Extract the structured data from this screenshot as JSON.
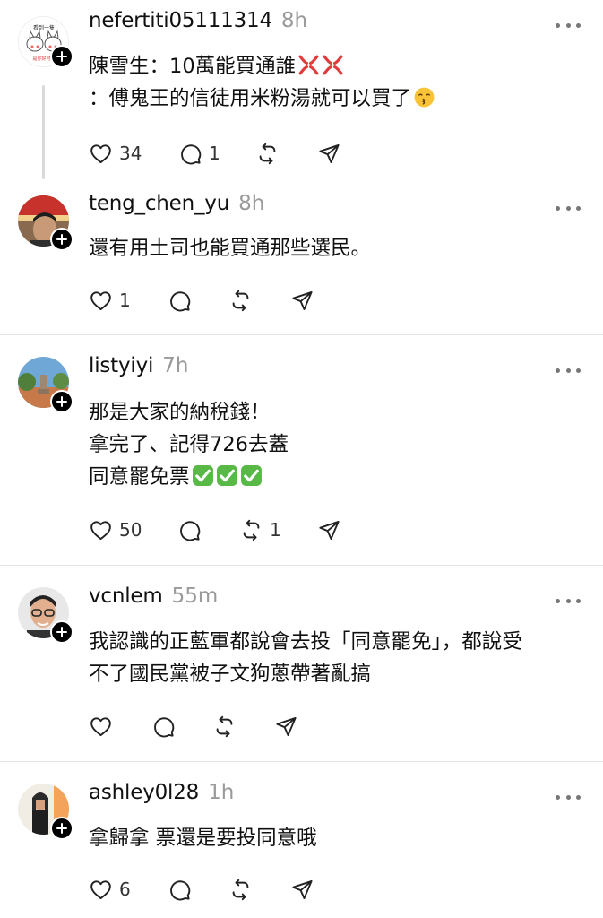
{
  "icons": {
    "like": "heart-icon",
    "reply": "comment-bubble-icon",
    "repost": "repost-arrows-icon",
    "share": "send-paper-plane-icon",
    "more": "ellipsis-icon",
    "follow": "plus-icon"
  },
  "colors": {
    "text": "#101010",
    "muted": "#9a9a9a",
    "icon": "#333333",
    "divider": "#e4e4e4"
  },
  "avatar_texts": {
    "cat_sign": "看到一隻",
    "cat_bottom": "是你好可愛"
  },
  "emoji_names": {
    "anger": "anger-symbol-emoji",
    "kiss": "kissing-face-emoji",
    "check": "check-mark-button-emoji"
  },
  "posts": [
    {
      "username": "nefertiti05111314",
      "time": "8h",
      "text_lines": [
        "陳雪生：10萬能買通誰",
        "：傅鬼王的信徒用米粉湯就可以買了"
      ],
      "likes": "34",
      "replies": "1",
      "reposts": ""
    },
    {
      "username": "teng_chen_yu",
      "time": "8h",
      "text_lines": [
        "還有用土司也能買通那些選民。"
      ],
      "likes": "1",
      "replies": "",
      "reposts": ""
    },
    {
      "username": "listyiyi",
      "time": "7h",
      "text_lines": [
        "那是大家的納稅錢！",
        "拿完了、記得726去蓋",
        "同意罷免票"
      ],
      "likes": "50",
      "replies": "",
      "reposts": "1"
    },
    {
      "username": "vcnlem",
      "time": "55m",
      "text_lines": [
        "我認識的正藍軍都說會去投「同意罷免」，都說受",
        "不了國民黨被子文狗蔥帶著亂搞"
      ],
      "likes": "",
      "replies": "",
      "reposts": ""
    },
    {
      "username": "ashley0l28",
      "time": "1h",
      "text_lines": [
        "拿歸拿 票還是要投同意哦"
      ],
      "likes": "6",
      "replies": "",
      "reposts": ""
    }
  ]
}
